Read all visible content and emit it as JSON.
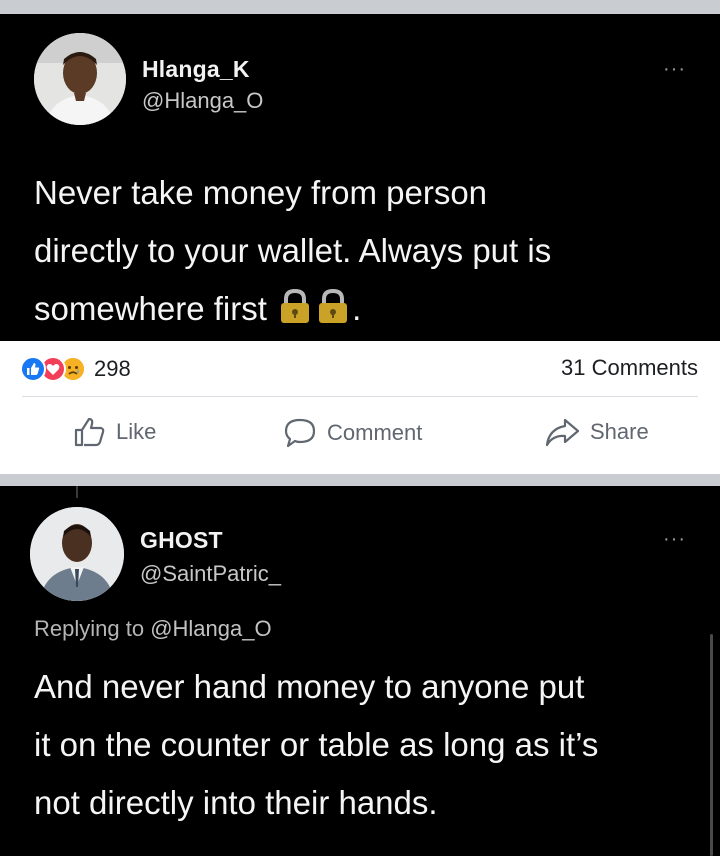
{
  "tweet1": {
    "name": "Hlanga_K",
    "handle": "@Hlanga_O",
    "more": "···",
    "lines": [
      "Never take money from person",
      "directly to your wallet. Always put is",
      "somewhere first"
    ],
    "line3_suffix": "."
  },
  "facebook": {
    "reaction_count": "298",
    "comments": "31 Comments",
    "like": "Like",
    "comment": "Comment",
    "share": "Share",
    "colors": {
      "like": "#1877f2",
      "love": "#f33e58",
      "sad": "#f7b125"
    }
  },
  "tweet2": {
    "name": "GHOST",
    "handle": "@SaintPatric_",
    "more": "···",
    "replying_prefix": "Replying to",
    "replying_handle": "@Hlanga_O",
    "lines": [
      "And never hand money to anyone put",
      "it on the counter or table as long as it’s",
      "not directly into their hands."
    ]
  }
}
